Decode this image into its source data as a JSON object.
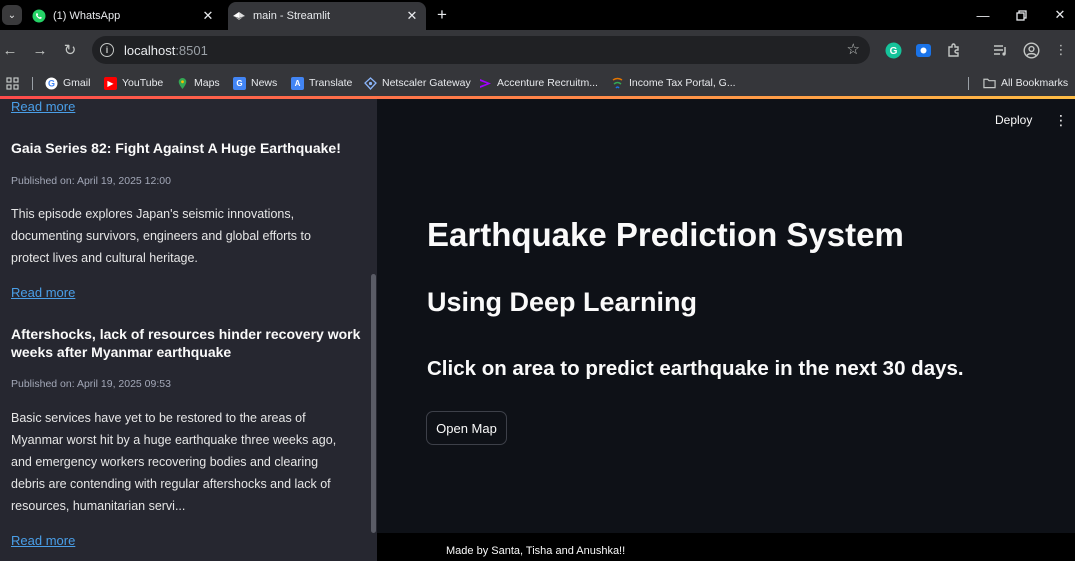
{
  "browser": {
    "tabs": [
      {
        "label": "(1) WhatsApp",
        "icon": "whatsapp-icon",
        "active": false
      },
      {
        "label": "main - Streamlit",
        "icon": "streamlit-icon",
        "active": true
      }
    ],
    "new_tab_symbol": "+",
    "url_host": "localhost",
    "url_port": ":8501",
    "bookmarks": [
      {
        "label": "Gmail",
        "icon": "google-icon",
        "color": "#ffffff"
      },
      {
        "label": "YouTube",
        "icon": "youtube-icon",
        "color": "#ff0000"
      },
      {
        "label": "Maps",
        "icon": "maps-icon",
        "color": "#34a853"
      },
      {
        "label": "News",
        "icon": "news-icon",
        "color": "#4285f4"
      },
      {
        "label": "Translate",
        "icon": "translate-icon",
        "color": "#4285f4"
      },
      {
        "label": "Netscaler Gateway",
        "icon": "netscaler-icon",
        "color": "#8ab4f8"
      },
      {
        "label": "Accenture Recruitm...",
        "icon": "accenture-icon",
        "color": "#a100ff"
      },
      {
        "label": "Income Tax Portal, G...",
        "icon": "income-tax-icon",
        "color": "#e37400"
      }
    ],
    "all_bookmarks": "All Bookmarks"
  },
  "sidebar": {
    "read_more": "Read more",
    "articles": [
      {
        "title": "Gaia Series 82: Fight Against A Huge Earthquake!",
        "published": "Published on: April 19, 2025 12:00",
        "lines": [
          "This episode explores Japan's seismic innovations,",
          "documenting survivors, engineers and global efforts to",
          "protect lives and cultural heritage."
        ]
      },
      {
        "title_lines": [
          "Aftershocks, lack of resources hinder recovery work",
          "weeks after Myanmar earthquake"
        ],
        "published": "Published on: April 19, 2025 09:53",
        "lines": [
          "Basic services have yet to be restored to the areas of",
          "Myanmar worst hit by a huge earthquake three weeks ago,",
          "and emergency workers recovering bodies and clearing",
          "debris are contending with regular aftershocks and lack of",
          "resources, humanitarian servi..."
        ]
      }
    ]
  },
  "main": {
    "deploy": "Deploy",
    "title": "Earthquake Prediction System",
    "subtitle": "Using Deep Learning",
    "instruction": "Click on area to predict earthquake in the next 30 days.",
    "open_map": "Open Map",
    "footer": "Made by Santa, Tisha and Anushka!!"
  },
  "colors": {
    "background": "#0e1117",
    "sidebar": "#262730",
    "link": "#4a9fe8",
    "accent": "#ff4b4b"
  }
}
